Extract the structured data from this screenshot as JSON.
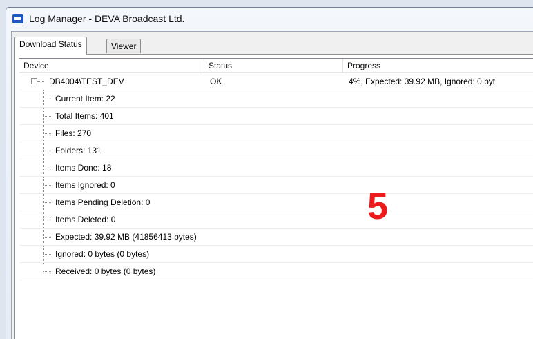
{
  "window": {
    "title": "Log Manager - DEVA Broadcast Ltd."
  },
  "tabs": [
    {
      "label": "Download Status"
    },
    {
      "label": "Viewer"
    }
  ],
  "columns": {
    "device": "Device",
    "status": "Status",
    "progress": "Progress"
  },
  "device": {
    "name": "DB4004\\TEST_DEV",
    "status": "OK",
    "progress": "4%, Expected: 39.92 MB, Ignored: 0 byt",
    "children": [
      "Current Item: 22",
      "Total Items: 401",
      "Files: 270",
      "Folders: 131",
      "Items Done: 18",
      "Items Ignored: 0",
      "Items Pending Deletion: 0",
      "Items Deleted: 0",
      "Expected: 39.92 MB (41856413 bytes)",
      "Ignored: 0 bytes (0 bytes)",
      "Received: 0 bytes (0 bytes)"
    ]
  },
  "annotation": {
    "label": "5",
    "color": "#ec1c1c"
  },
  "icons": {
    "app": "app-window-icon",
    "collapse": "tree-collapse-icon"
  }
}
